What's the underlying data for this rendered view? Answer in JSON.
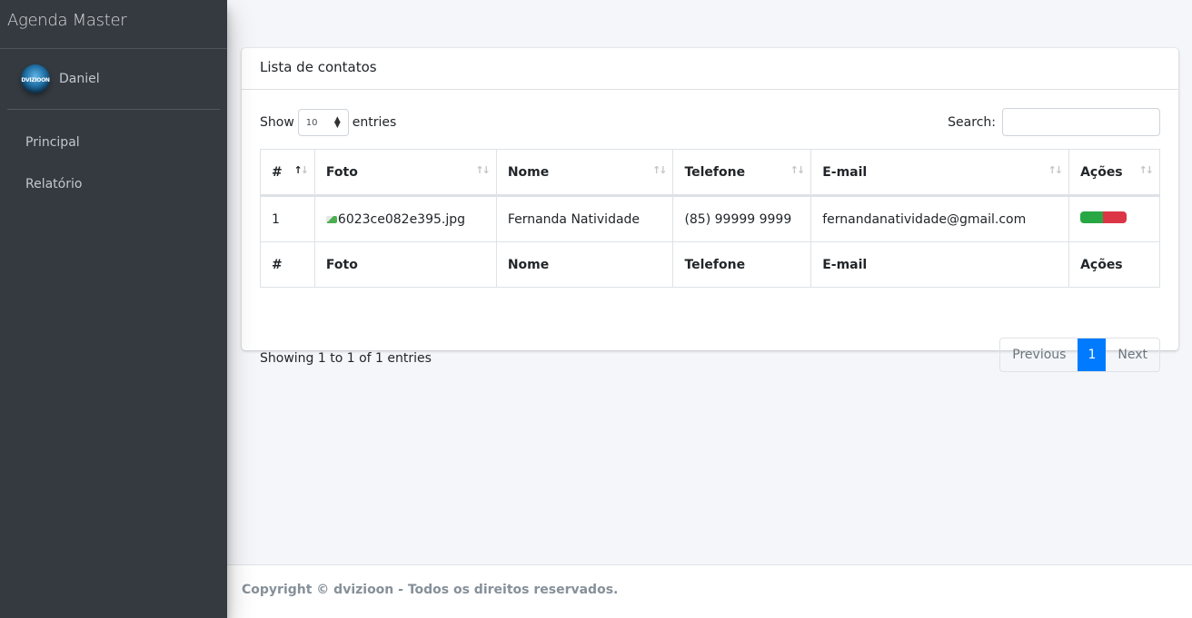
{
  "app": {
    "title": "Agenda Master"
  },
  "user": {
    "name": "Daniel",
    "avatar_text": "DVIZIOON"
  },
  "sidebar": {
    "items": [
      {
        "label": "Principal"
      },
      {
        "label": "Relatório"
      }
    ]
  },
  "card": {
    "title": "Lista de contatos",
    "length": {
      "prefix": "Show",
      "value": "10",
      "suffix": "entries"
    },
    "search": {
      "label": "Search:",
      "value": "",
      "placeholder": ""
    },
    "columns": [
      "#",
      "Foto",
      "Nome",
      "Telefone",
      "E-mail",
      "Ações"
    ],
    "rows": [
      {
        "id": "1",
        "foto": "6023ce082e395.jpg",
        "nome": "Fernanda Natividade",
        "telefone": "(85) 99999 9999",
        "email": "fernandanatividade@gmail.com"
      }
    ],
    "info": "Showing 1 to 1 of 1 entries",
    "pagination": {
      "previous": "Previous",
      "current": "1",
      "next": "Next"
    }
  },
  "footer": {
    "text": "Copyright © dvizioon - Todos os direitos reservados."
  },
  "colors": {
    "sidebar_bg": "#343a40",
    "accent": "#007bff",
    "edit": "#28a745",
    "delete": "#dc3545"
  }
}
